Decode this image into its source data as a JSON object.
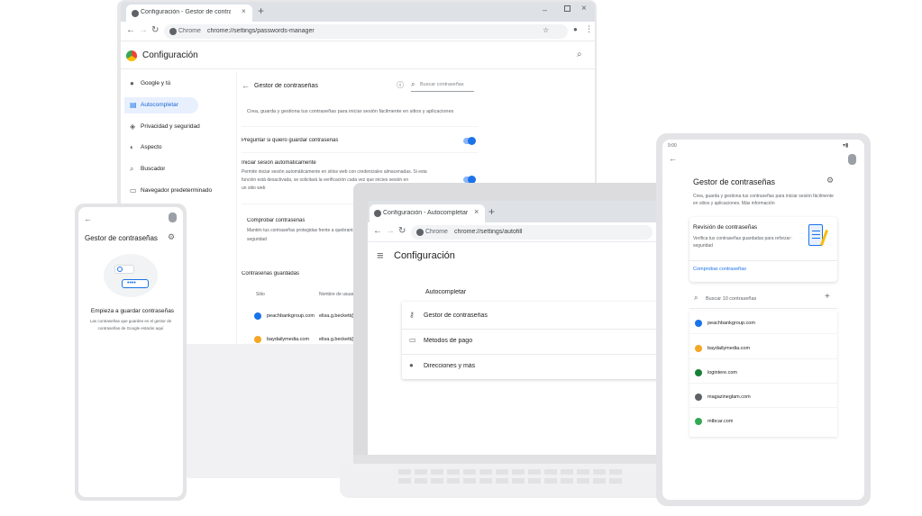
{
  "laptop": {
    "tab_title": "Configuración - Gestor de contraseñas",
    "new_tab": "+",
    "omnibox_label": "Chrome",
    "omnibox_url": "chrome://settings/passwords-manager",
    "settings_title": "Configuración",
    "sidebar": {
      "items": [
        {
          "label": "Google y tú"
        },
        {
          "label": "Autocompletar"
        },
        {
          "label": "Privacidad y seguridad"
        },
        {
          "label": "Aspecto"
        },
        {
          "label": "Buscador"
        },
        {
          "label": "Navegador predeterminado"
        }
      ]
    },
    "panel": {
      "title": "Gestor de contraseñas",
      "search_placeholder": "Buscar contraseñas",
      "description": "Crea, guarda y gestiona tus contraseñas para iniciar sesión fácilmente en sitios y aplicaciones",
      "offer_save": "Preguntar si quiero guardar contraseñas",
      "auto_signin_title": "Iniciar sesión automáticamente",
      "auto_signin_desc_1": "Permite iniciar sesión automáticamente en sitios web con credenciales almacenadas. Si esta",
      "auto_signin_desc_2": "función está desactivada, se solicitará la verificación cada vez que inicies sesión en",
      "auto_signin_desc_3": "un sitio web",
      "check_title": "Comprobar contraseñas",
      "check_desc_1": "Mantén tus contraseñas protegidas frente a quebrantamientos de datos y otros problemas de",
      "check_desc_2": "seguridad",
      "saved_title": "Contraseñas guardadas",
      "col_site": "Sitio",
      "col_user": "Nombre de usuario",
      "rows": [
        {
          "site": "peachbankgroup.com",
          "user": "elisa.g.beckett@gmail.com"
        },
        {
          "site": "baydailymedia.com",
          "user": "elisa.g.beckett@gmail.com"
        }
      ]
    }
  },
  "laptop2": {
    "tab_title": "Configuración - Autocompletar",
    "new_tab": "+",
    "omnibox_label": "Chrome",
    "omnibox_url": "chrome://settings/autofill",
    "settings_title": "Configuración",
    "section_title": "Autocompletar",
    "items": [
      {
        "label": "Gestor de contraseñas"
      },
      {
        "label": "Métodos de pago"
      },
      {
        "label": "Direcciones y más"
      }
    ]
  },
  "phone": {
    "title": "Gestor de contraseñas",
    "empty_title": "Empieza a guardar contraseñas",
    "empty_desc_1": "Las contraseñas que guardes en el gestor de",
    "empty_desc_2": "contraseñas de Google estarán aquí",
    "dots": "••••"
  },
  "tablet": {
    "time": "9:00",
    "title": "Gestor de contraseñas",
    "description_1": "Crea, guarda y gestiona tus contraseñas para iniciar sesión fácilmente",
    "description_2": "en sitios y aplicaciones. Más información",
    "review_title": "Revisión de contraseñas",
    "review_desc_1": "Verifica tus contraseñas guardadas para reforzar tu",
    "review_desc_2": "seguridad",
    "check_link": "Comprobar contraseñas",
    "search_placeholder": "Buscar 10 contraseñas",
    "add": "+",
    "sites": [
      {
        "name": "peachbankgroup.com",
        "color": "#1a73e8"
      },
      {
        "name": "baydailymedia.com",
        "color": "#f5a623"
      },
      {
        "name": "logintere.com",
        "color": "#188038"
      },
      {
        "name": "magazineglam.com",
        "color": "#5f6368"
      },
      {
        "name": "mtbcar.com",
        "color": "#34a853"
      }
    ]
  },
  "colors": {
    "accent": "#1a73e8",
    "selected_bg": "#e8f0fe",
    "device_frame": "#e4e4e7"
  }
}
